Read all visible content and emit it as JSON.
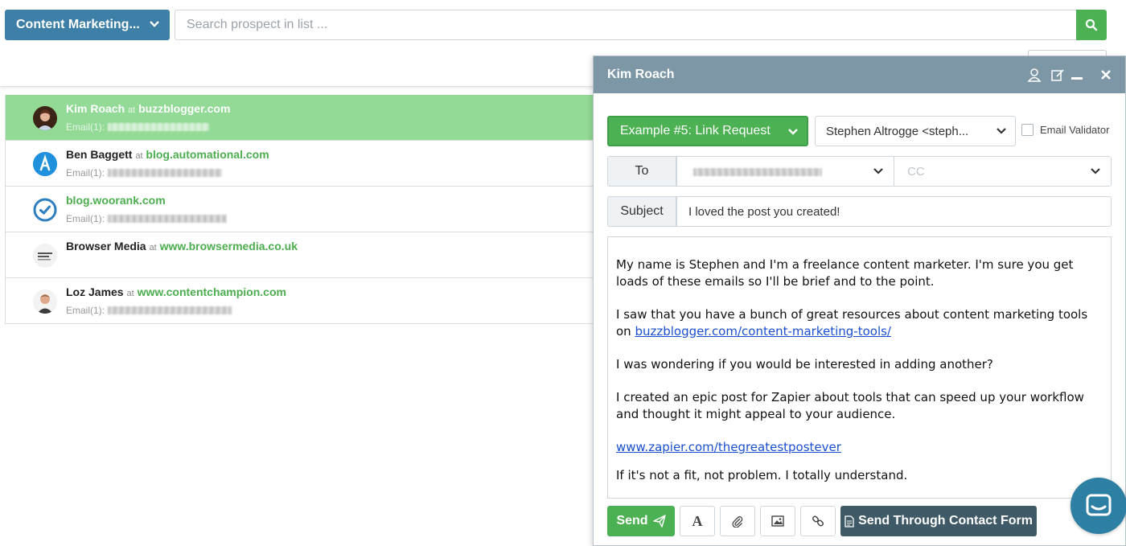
{
  "topbar": {
    "list_select_label": "Content Marketing...",
    "search_placeholder": "Search prospect in list ..."
  },
  "prospects": [
    {
      "name": "Kim Roach",
      "at": "at",
      "domain": "buzzblogger.com",
      "email_label": "Email(1):",
      "active": true
    },
    {
      "name": "Ben Baggett",
      "at": "at",
      "domain": "blog.automational.com",
      "email_label": "Email(1):",
      "active": false
    },
    {
      "name": "",
      "at": "",
      "domain": "blog.woorank.com",
      "email_label": "Email(1):",
      "active": false
    },
    {
      "name": "Browser Media",
      "at": "at",
      "domain": "www.browsermedia.co.uk",
      "email_label": "",
      "active": false
    },
    {
      "name": "Loz James",
      "at": "at",
      "domain": "www.contentchampion.com",
      "email_label": "Email(1):",
      "active": false
    }
  ],
  "compose": {
    "title": "Kim Roach",
    "template_label": "Example #5: Link Request",
    "from_label": "Stephen Altrogge <steph...",
    "validator_label": "Email Validator",
    "to_label": "To",
    "cc_placeholder": "CC",
    "subject_label": "Subject",
    "subject_value": "I loved the post you created!",
    "body": {
      "p1": "My name is Stephen and I'm a freelance content marketer. I'm sure you get loads of these emails so I'll be brief and to the point.",
      "p2_text": "I saw that you have a bunch of great resources about content marketing tools on",
      "p2_link": "buzzblogger.com/content-marketing-tools/",
      "p3": "I was wondering if you would be interested in adding another?",
      "p4": "I created an epic post for Zapier about tools that can speed up your workflow and thought it might appeal to your audience.",
      "p5_link": "www.zapier.com/thegreatestpostever",
      "p6": "If it's not a fit, not problem. I totally understand."
    },
    "send_label": "Send",
    "format_label": "A",
    "contact_form_label": "Send Through Contact Form"
  },
  "avatars": {
    "browser_media_logo_text": "BROWSER MEDIA"
  },
  "colors": {
    "primary_blue": "#3d7fa6",
    "green": "#4cb152",
    "active_row": "#92da96",
    "header_gray": "#7d97a6",
    "dark_button": "#3f5a66"
  }
}
